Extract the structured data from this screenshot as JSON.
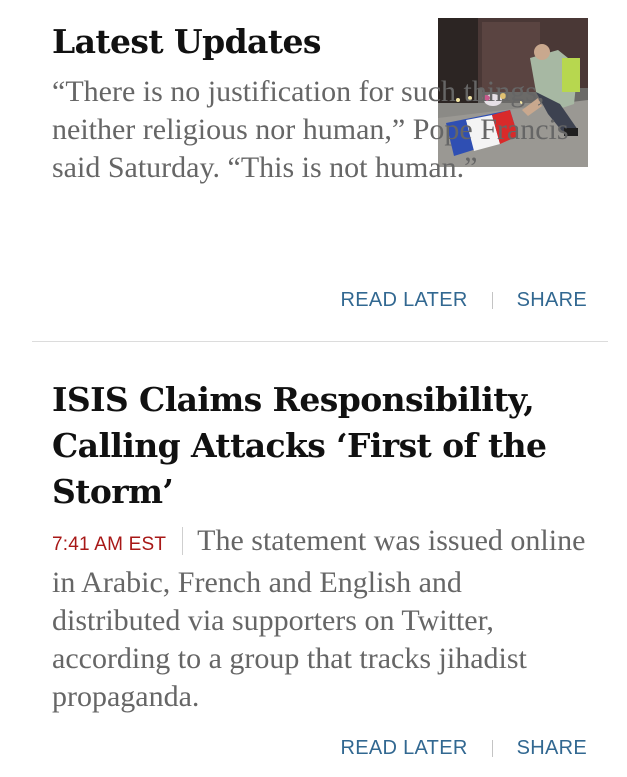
{
  "articles": [
    {
      "headline": "Latest Updates",
      "summary": "“There is no justification for such things, neither religious nor human,” Pope Francis said Saturday. “This is not human.”",
      "actions": {
        "read_later": "READ LATER",
        "share": "SHARE"
      }
    },
    {
      "headline": "ISIS Claims Responsibility, Calling Attacks ‘First of the Storm’",
      "timestamp": "7:41 AM EST",
      "summary": "The statement was issued online in Arabic, French and English and distributed via supporters on Twitter, according to a group that tracks jihadist propaganda.",
      "actions": {
        "read_later": "READ LATER",
        "share": "SHARE"
      }
    }
  ],
  "colors": {
    "timestamp": "#a81817",
    "action_link": "#326891",
    "headline": "#111111",
    "summary": "#666666"
  }
}
